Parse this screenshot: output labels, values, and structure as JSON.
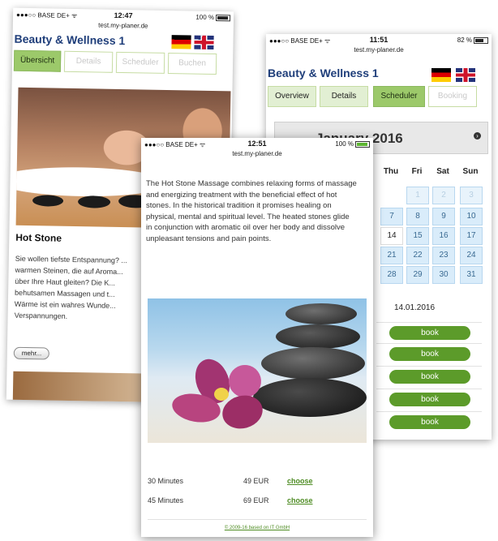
{
  "left_phone": {
    "status": {
      "carrier": "●●●○○ BASE DE+ ᯤ",
      "time": "12:47",
      "battery": "100 %"
    },
    "url": "test.my-planer.de",
    "brand_title": "Beauty & Wellness 1",
    "tabs": [
      "Übersicht",
      "Details",
      "Scheduler",
      "Buchen"
    ],
    "service_title": "Hot Stone",
    "description": "Sie wollen tiefste Entspannung? ... warmen Steinen, die auf Aroma... über Ihre Haut gleiten? Die K... behutsamen Massagen und t... Wärme ist ein wahres Wunde... Verspannungen.",
    "more_button": "mehr..."
  },
  "right_phone": {
    "status": {
      "carrier": "●●●○○ BASE DE+ ᯤ",
      "time": "11:51",
      "battery": "82 %"
    },
    "url": "test.my-planer.de",
    "brand_title": "Beauty & Wellness 1",
    "tabs": [
      "Overview",
      "Details",
      "Scheduler",
      "Booking"
    ],
    "calendar": {
      "month_title": "January 2016",
      "weekdays": [
        "Thu",
        "Fri",
        "Sat",
        "Sun"
      ],
      "rows": [
        [
          "",
          "1",
          "2",
          "3"
        ],
        [
          "7",
          "8",
          "9",
          "10"
        ],
        [
          "14",
          "15",
          "16",
          "17"
        ],
        [
          "21",
          "22",
          "23",
          "24"
        ],
        [
          "28",
          "29",
          "30",
          "31"
        ]
      ]
    },
    "selected_date": "14.01.2016",
    "book_label": "book"
  },
  "front_phone": {
    "status": {
      "carrier": "●●●○○ BASE DE+ ᯤ",
      "time": "12:51",
      "battery": "100 %"
    },
    "url": "test.my-planer.de",
    "description": "The Hot Stone Massage combines relaxing forms of massage and energizing treatment with the beneficial effect of hot stones. In the historical tradition it promises healing on physical, mental and spiritual level. The heated stones glide in conjunction with aromatic oil over her body and dissolve unpleasant tensions and pain points.",
    "prices": [
      {
        "duration": "30 Minutes",
        "price": "49 EUR",
        "action": "choose"
      },
      {
        "duration": "45 Minutes",
        "price": "69 EUR",
        "action": "choose"
      }
    ],
    "footer": "© 2009-16 based on IT GmbH"
  },
  "colors": {
    "brand_blue": "#1f3e7a",
    "tab_active_green": "#9cc96a",
    "book_green": "#5c9b2a",
    "calendar_blue": "#d9ecfa",
    "link_green": "#4e8c23"
  }
}
